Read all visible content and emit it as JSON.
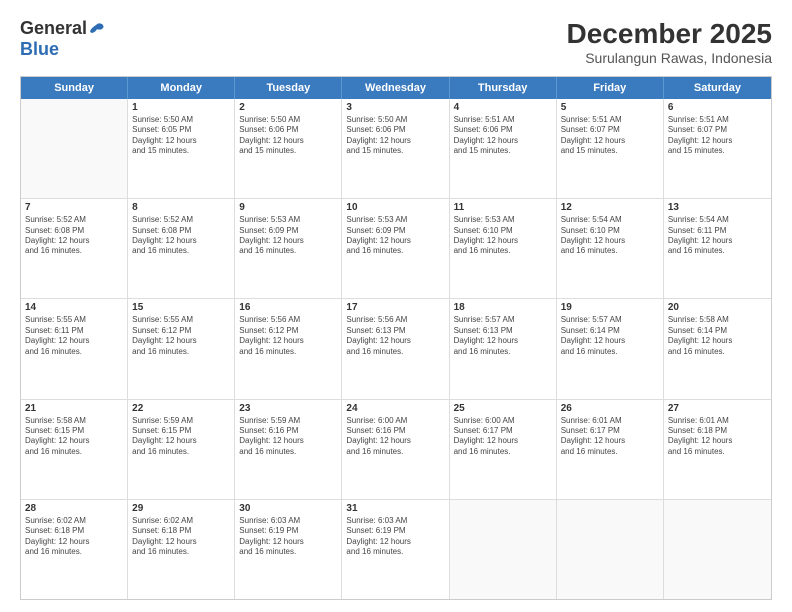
{
  "header": {
    "logo_general": "General",
    "logo_blue": "Blue",
    "month_year": "December 2025",
    "location": "Surulangun Rawas, Indonesia"
  },
  "calendar": {
    "days_of_week": [
      "Sunday",
      "Monday",
      "Tuesday",
      "Wednesday",
      "Thursday",
      "Friday",
      "Saturday"
    ],
    "rows": [
      [
        {
          "day": "",
          "empty": true
        },
        {
          "day": "1",
          "line1": "Sunrise: 5:50 AM",
          "line2": "Sunset: 6:05 PM",
          "line3": "Daylight: 12 hours",
          "line4": "and 15 minutes."
        },
        {
          "day": "2",
          "line1": "Sunrise: 5:50 AM",
          "line2": "Sunset: 6:06 PM",
          "line3": "Daylight: 12 hours",
          "line4": "and 15 minutes."
        },
        {
          "day": "3",
          "line1": "Sunrise: 5:50 AM",
          "line2": "Sunset: 6:06 PM",
          "line3": "Daylight: 12 hours",
          "line4": "and 15 minutes."
        },
        {
          "day": "4",
          "line1": "Sunrise: 5:51 AM",
          "line2": "Sunset: 6:06 PM",
          "line3": "Daylight: 12 hours",
          "line4": "and 15 minutes."
        },
        {
          "day": "5",
          "line1": "Sunrise: 5:51 AM",
          "line2": "Sunset: 6:07 PM",
          "line3": "Daylight: 12 hours",
          "line4": "and 15 minutes."
        },
        {
          "day": "6",
          "line1": "Sunrise: 5:51 AM",
          "line2": "Sunset: 6:07 PM",
          "line3": "Daylight: 12 hours",
          "line4": "and 15 minutes."
        }
      ],
      [
        {
          "day": "7",
          "line1": "Sunrise: 5:52 AM",
          "line2": "Sunset: 6:08 PM",
          "line3": "Daylight: 12 hours",
          "line4": "and 16 minutes."
        },
        {
          "day": "8",
          "line1": "Sunrise: 5:52 AM",
          "line2": "Sunset: 6:08 PM",
          "line3": "Daylight: 12 hours",
          "line4": "and 16 minutes."
        },
        {
          "day": "9",
          "line1": "Sunrise: 5:53 AM",
          "line2": "Sunset: 6:09 PM",
          "line3": "Daylight: 12 hours",
          "line4": "and 16 minutes."
        },
        {
          "day": "10",
          "line1": "Sunrise: 5:53 AM",
          "line2": "Sunset: 6:09 PM",
          "line3": "Daylight: 12 hours",
          "line4": "and 16 minutes."
        },
        {
          "day": "11",
          "line1": "Sunrise: 5:53 AM",
          "line2": "Sunset: 6:10 PM",
          "line3": "Daylight: 12 hours",
          "line4": "and 16 minutes."
        },
        {
          "day": "12",
          "line1": "Sunrise: 5:54 AM",
          "line2": "Sunset: 6:10 PM",
          "line3": "Daylight: 12 hours",
          "line4": "and 16 minutes."
        },
        {
          "day": "13",
          "line1": "Sunrise: 5:54 AM",
          "line2": "Sunset: 6:11 PM",
          "line3": "Daylight: 12 hours",
          "line4": "and 16 minutes."
        }
      ],
      [
        {
          "day": "14",
          "line1": "Sunrise: 5:55 AM",
          "line2": "Sunset: 6:11 PM",
          "line3": "Daylight: 12 hours",
          "line4": "and 16 minutes."
        },
        {
          "day": "15",
          "line1": "Sunrise: 5:55 AM",
          "line2": "Sunset: 6:12 PM",
          "line3": "Daylight: 12 hours",
          "line4": "and 16 minutes."
        },
        {
          "day": "16",
          "line1": "Sunrise: 5:56 AM",
          "line2": "Sunset: 6:12 PM",
          "line3": "Daylight: 12 hours",
          "line4": "and 16 minutes."
        },
        {
          "day": "17",
          "line1": "Sunrise: 5:56 AM",
          "line2": "Sunset: 6:13 PM",
          "line3": "Daylight: 12 hours",
          "line4": "and 16 minutes."
        },
        {
          "day": "18",
          "line1": "Sunrise: 5:57 AM",
          "line2": "Sunset: 6:13 PM",
          "line3": "Daylight: 12 hours",
          "line4": "and 16 minutes."
        },
        {
          "day": "19",
          "line1": "Sunrise: 5:57 AM",
          "line2": "Sunset: 6:14 PM",
          "line3": "Daylight: 12 hours",
          "line4": "and 16 minutes."
        },
        {
          "day": "20",
          "line1": "Sunrise: 5:58 AM",
          "line2": "Sunset: 6:14 PM",
          "line3": "Daylight: 12 hours",
          "line4": "and 16 minutes."
        }
      ],
      [
        {
          "day": "21",
          "line1": "Sunrise: 5:58 AM",
          "line2": "Sunset: 6:15 PM",
          "line3": "Daylight: 12 hours",
          "line4": "and 16 minutes."
        },
        {
          "day": "22",
          "line1": "Sunrise: 5:59 AM",
          "line2": "Sunset: 6:15 PM",
          "line3": "Daylight: 12 hours",
          "line4": "and 16 minutes."
        },
        {
          "day": "23",
          "line1": "Sunrise: 5:59 AM",
          "line2": "Sunset: 6:16 PM",
          "line3": "Daylight: 12 hours",
          "line4": "and 16 minutes."
        },
        {
          "day": "24",
          "line1": "Sunrise: 6:00 AM",
          "line2": "Sunset: 6:16 PM",
          "line3": "Daylight: 12 hours",
          "line4": "and 16 minutes."
        },
        {
          "day": "25",
          "line1": "Sunrise: 6:00 AM",
          "line2": "Sunset: 6:17 PM",
          "line3": "Daylight: 12 hours",
          "line4": "and 16 minutes."
        },
        {
          "day": "26",
          "line1": "Sunrise: 6:01 AM",
          "line2": "Sunset: 6:17 PM",
          "line3": "Daylight: 12 hours",
          "line4": "and 16 minutes."
        },
        {
          "day": "27",
          "line1": "Sunrise: 6:01 AM",
          "line2": "Sunset: 6:18 PM",
          "line3": "Daylight: 12 hours",
          "line4": "and 16 minutes."
        }
      ],
      [
        {
          "day": "28",
          "line1": "Sunrise: 6:02 AM",
          "line2": "Sunset: 6:18 PM",
          "line3": "Daylight: 12 hours",
          "line4": "and 16 minutes."
        },
        {
          "day": "29",
          "line1": "Sunrise: 6:02 AM",
          "line2": "Sunset: 6:18 PM",
          "line3": "Daylight: 12 hours",
          "line4": "and 16 minutes."
        },
        {
          "day": "30",
          "line1": "Sunrise: 6:03 AM",
          "line2": "Sunset: 6:19 PM",
          "line3": "Daylight: 12 hours",
          "line4": "and 16 minutes."
        },
        {
          "day": "31",
          "line1": "Sunrise: 6:03 AM",
          "line2": "Sunset: 6:19 PM",
          "line3": "Daylight: 12 hours",
          "line4": "and 16 minutes."
        },
        {
          "day": "",
          "empty": true
        },
        {
          "day": "",
          "empty": true
        },
        {
          "day": "",
          "empty": true
        }
      ]
    ]
  }
}
